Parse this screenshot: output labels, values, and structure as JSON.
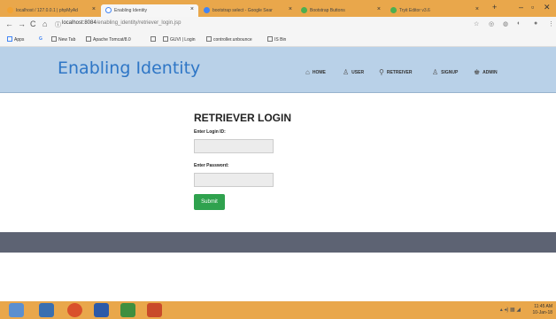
{
  "browser": {
    "tabs": [
      {
        "label": "localhost / 127.0.0.1 | phpMyAd",
        "color": "#f2a232"
      },
      {
        "label": "Enabling Identity",
        "color": "#4285f4"
      },
      {
        "label": "bootstrap select - Google Sear",
        "color": "#4285f4"
      },
      {
        "label": "Bootstrap Buttons",
        "color": "#4caf50"
      },
      {
        "label": "Tryit Editor v3.6",
        "color": "#4caf50"
      }
    ],
    "new_tab_label": "+",
    "window_buttons": {
      "minimize": "–",
      "maximize": "▫",
      "close": "✕"
    },
    "nav": {
      "back": "←",
      "forward": "→",
      "reload": "C",
      "home": "⌂"
    },
    "url_host": "localhost:8084",
    "url_path": "/enabling_identity/retriever_login.jsp",
    "bookmarks": [
      "Apps",
      "G",
      "New Tab",
      "Apache Tomcat/8.0",
      "",
      "GUVI | Login",
      "controller.unbounce",
      "IS Bin"
    ]
  },
  "header": {
    "brand": "Enabling Identity",
    "menu": [
      {
        "label": "HOME",
        "icon": "home-icon"
      },
      {
        "label": "USER",
        "icon": "user-icon"
      },
      {
        "label": "RETREIVER",
        "icon": "search-icon"
      },
      {
        "label": "SIGNUP",
        "icon": "user-icon"
      },
      {
        "label": "ADMIN",
        "icon": "users-icon"
      }
    ]
  },
  "form": {
    "title": "RETRIEVER LOGIN",
    "login_label": "Enter Login ID:",
    "login_value": "",
    "password_label": "Enter Password:",
    "password_value": "",
    "submit_label": "Submit"
  },
  "taskbar": {
    "clock_time": "11:45 AM",
    "clock_date": "10-Jan-18"
  }
}
